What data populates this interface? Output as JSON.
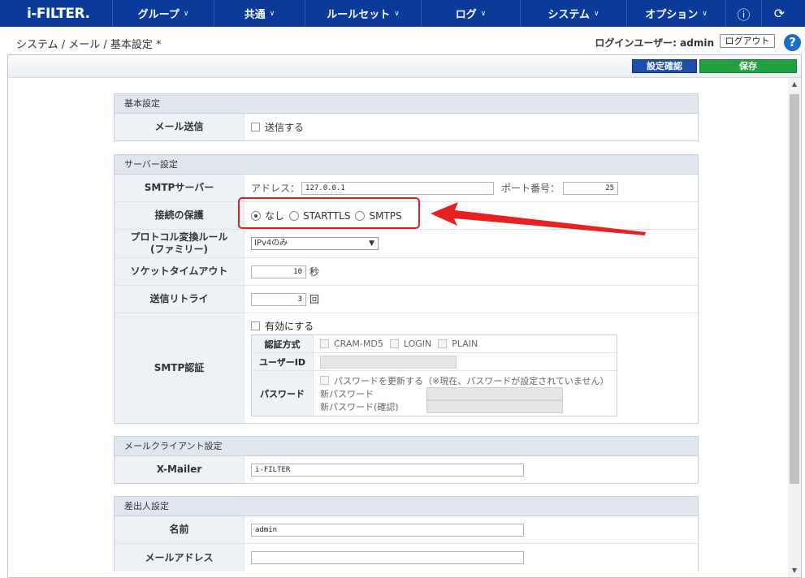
{
  "nav": {
    "logo": "i-FILTER.",
    "items": [
      {
        "label": "グループ"
      },
      {
        "label": "共通"
      },
      {
        "label": "ルールセット"
      },
      {
        "label": "ログ"
      },
      {
        "label": "システム"
      },
      {
        "label": "オプション"
      }
    ]
  },
  "header": {
    "breadcrumb": "システム / メール / 基本設定 *",
    "login_user": "ログインユーザー: admin",
    "logout": "ログアウト"
  },
  "toolbar": {
    "confirm": "設定確認",
    "save": "保存"
  },
  "basic": {
    "title": "基本設定",
    "mail_send_label": "メール送信",
    "mail_send_option": "送信する"
  },
  "server": {
    "title": "サーバー設定",
    "smtp_label": "SMTPサーバー",
    "address_label": "アドレス：",
    "address_value": "127.0.0.1",
    "port_label": "ポート番号：",
    "port_value": "25",
    "protection_label": "接続の保護",
    "protection_options": [
      "なし",
      "STARTTLS",
      "SMTPS"
    ],
    "protocol_label_1": "プロトコル変換ルール",
    "protocol_label_2": "(ファミリー)",
    "protocol_value": "IPv4のみ",
    "timeout_label": "ソケットタイムアウト",
    "timeout_value": "10",
    "timeout_unit": "秒",
    "retry_label": "送信リトライ",
    "retry_value": "3",
    "retry_unit": "回",
    "auth_label": "SMTP認証",
    "auth_enable": "有効にする",
    "auth_method_label": "認証方式",
    "auth_methods": [
      "CRAM-MD5",
      "LOGIN",
      "PLAIN"
    ],
    "user_id_label": "ユーザーID",
    "password_label": "パスワード",
    "password_update": "パスワードを更新する（※現在、パスワードが設定されていません）",
    "new_password": "新パスワード",
    "new_password_confirm": "新パスワード(確認)"
  },
  "client": {
    "title": "メールクライアント設定",
    "xmailer_label": "X-Mailer",
    "xmailer_value": "i-FILTER"
  },
  "sender": {
    "title": "差出人設定",
    "name_label": "名前",
    "name_value": "admin",
    "email_label": "メールアドレス",
    "email_value": ""
  },
  "colors": {
    "nav": "#0b3a9a",
    "confirm": "#1e4fa8",
    "save": "#23a043",
    "annotation": "#e02020"
  },
  "selected_protection": "なし"
}
